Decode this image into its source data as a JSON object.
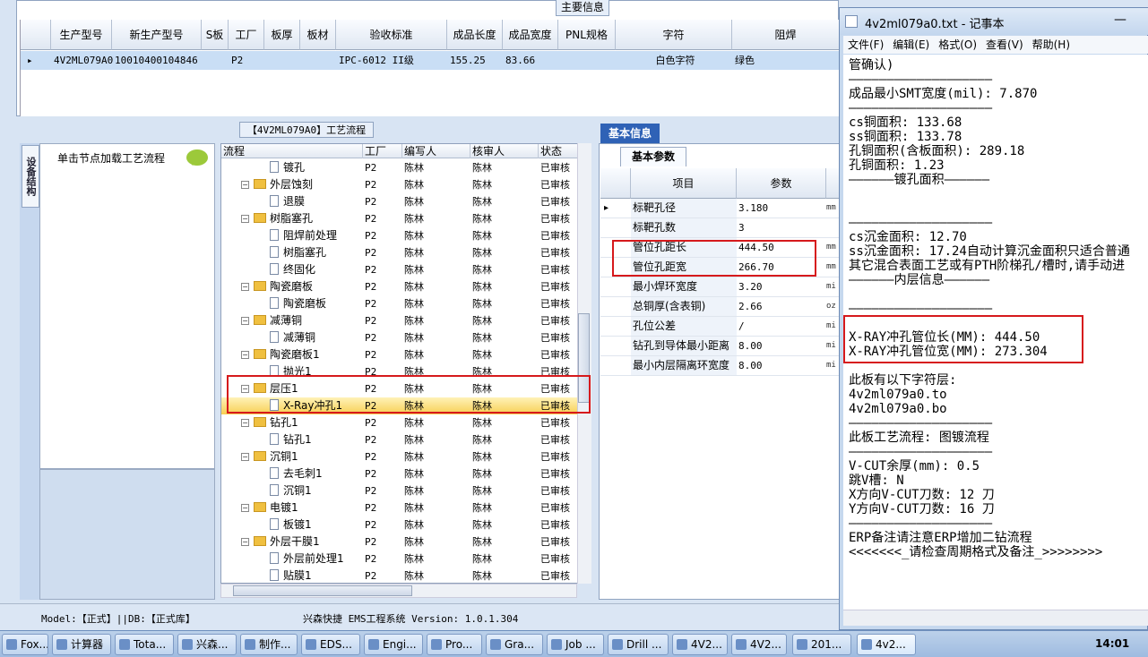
{
  "top_panel": {
    "title": "主要信息",
    "columns": [
      "生产型号",
      "新生产型号",
      "S板",
      "工厂",
      "板厚",
      "板材",
      "验收标准",
      "成品长度",
      "成品宽度",
      "PNL规格",
      "字符",
      "阻焊"
    ],
    "row": {
      "model": "4V2ML079A0",
      "new_model": "10010400104846",
      "factory": "P2",
      "standard": "IPC-6012 II级",
      "length": "155.25",
      "width": "83.66",
      "char": "白色字符",
      "mask": "绿色"
    }
  },
  "flow_panel": {
    "title": "【4V2ML079A0】工艺流程",
    "device_tab": "设备结构",
    "device_hint": "单击节点加载工艺流程",
    "columns": [
      "流程",
      "工厂",
      "编写人",
      "核审人",
      "状态"
    ],
    "rows": [
      {
        "name": "镀孔",
        "level": 1,
        "factory": "P2",
        "writer": "陈林",
        "reviewer": "陈林",
        "status": "已审核"
      },
      {
        "name": "外层蚀刻",
        "level": 0,
        "factory": "P2",
        "writer": "陈林",
        "reviewer": "陈林",
        "status": "已审核"
      },
      {
        "name": "退膜",
        "level": 1,
        "factory": "P2",
        "writer": "陈林",
        "reviewer": "陈林",
        "status": "已审核"
      },
      {
        "name": "树脂塞孔",
        "level": 0,
        "factory": "P2",
        "writer": "陈林",
        "reviewer": "陈林",
        "status": "已审核"
      },
      {
        "name": "阻焊前处理",
        "level": 1,
        "factory": "P2",
        "writer": "陈林",
        "reviewer": "陈林",
        "status": "已审核"
      },
      {
        "name": "树脂塞孔",
        "level": 1,
        "factory": "P2",
        "writer": "陈林",
        "reviewer": "陈林",
        "status": "已审核"
      },
      {
        "name": "终固化",
        "level": 1,
        "factory": "P2",
        "writer": "陈林",
        "reviewer": "陈林",
        "status": "已审核"
      },
      {
        "name": "陶瓷磨板",
        "level": 0,
        "factory": "P2",
        "writer": "陈林",
        "reviewer": "陈林",
        "status": "已审核"
      },
      {
        "name": "陶瓷磨板",
        "level": 1,
        "factory": "P2",
        "writer": "陈林",
        "reviewer": "陈林",
        "status": "已审核"
      },
      {
        "name": "减薄铜",
        "level": 0,
        "factory": "P2",
        "writer": "陈林",
        "reviewer": "陈林",
        "status": "已审核"
      },
      {
        "name": "减薄铜",
        "level": 1,
        "factory": "P2",
        "writer": "陈林",
        "reviewer": "陈林",
        "status": "已审核"
      },
      {
        "name": "陶瓷磨板1",
        "level": 0,
        "factory": "P2",
        "writer": "陈林",
        "reviewer": "陈林",
        "status": "已审核"
      },
      {
        "name": "抛光1",
        "level": 1,
        "factory": "P2",
        "writer": "陈林",
        "reviewer": "陈林",
        "status": "已审核"
      },
      {
        "name": "层压1",
        "level": 0,
        "factory": "P2",
        "writer": "陈林",
        "reviewer": "陈林",
        "status": "已审核"
      },
      {
        "name": "X-Ray冲孔1",
        "level": 1,
        "factory": "P2",
        "writer": "陈林",
        "reviewer": "陈林",
        "status": "已审核",
        "selected": true
      },
      {
        "name": "钻孔1",
        "level": 0,
        "factory": "P2",
        "writer": "陈林",
        "reviewer": "陈林",
        "status": "已审核"
      },
      {
        "name": "钻孔1",
        "level": 1,
        "factory": "P2",
        "writer": "陈林",
        "reviewer": "陈林",
        "status": "已审核"
      },
      {
        "name": "沉铜1",
        "level": 0,
        "factory": "P2",
        "writer": "陈林",
        "reviewer": "陈林",
        "status": "已审核"
      },
      {
        "name": "去毛刺1",
        "level": 1,
        "factory": "P2",
        "writer": "陈林",
        "reviewer": "陈林",
        "status": "已审核"
      },
      {
        "name": "沉铜1",
        "level": 1,
        "factory": "P2",
        "writer": "陈林",
        "reviewer": "陈林",
        "status": "已审核"
      },
      {
        "name": "电镀1",
        "level": 0,
        "factory": "P2",
        "writer": "陈林",
        "reviewer": "陈林",
        "status": "已审核"
      },
      {
        "name": "板镀1",
        "level": 1,
        "factory": "P2",
        "writer": "陈林",
        "reviewer": "陈林",
        "status": "已审核"
      },
      {
        "name": "外层干膜1",
        "level": 0,
        "factory": "P2",
        "writer": "陈林",
        "reviewer": "陈林",
        "status": "已审核"
      },
      {
        "name": "外层前处理1",
        "level": 1,
        "factory": "P2",
        "writer": "陈林",
        "reviewer": "陈林",
        "status": "已审核"
      },
      {
        "name": "贴膜1",
        "level": 1,
        "factory": "P2",
        "writer": "陈林",
        "reviewer": "陈林",
        "status": "已审核"
      }
    ]
  },
  "basic_info": {
    "tab": "基本信息",
    "sub_tab": "基本参数",
    "columns": [
      "项目",
      "参数"
    ],
    "rows": [
      {
        "item": "标靶孔径",
        "value": "3.180",
        "unit": "mm"
      },
      {
        "item": "标靶孔数",
        "value": "3",
        "unit": ""
      },
      {
        "item": "管位孔距长",
        "value": "444.50",
        "unit": "mm"
      },
      {
        "item": "管位孔距宽",
        "value": "266.70",
        "unit": "mm"
      },
      {
        "item": "最小焊环宽度",
        "value": "3.20",
        "unit": "mi"
      },
      {
        "item": "总铜厚(含表铜)",
        "value": "2.66",
        "unit": "oz"
      },
      {
        "item": "孔位公差",
        "value": "/",
        "unit": "mi"
      },
      {
        "item": "钻孔到导体最小距离",
        "value": "8.00",
        "unit": "mi"
      },
      {
        "item": "最小内层隔离环宽度",
        "value": "8.00",
        "unit": "mi"
      }
    ]
  },
  "status_bar": {
    "left": "Model:【正式】||DB:【正式库】",
    "center": "兴森快捷 EMS工程系统 Version: 1.0.1.304"
  },
  "notepad": {
    "title": "4v2ml079a0.txt - 记事本",
    "menu": [
      "文件(F)",
      "编辑(E)",
      "格式(O)",
      "查看(V)",
      "帮助(H)"
    ],
    "lines": [
      "管确认)",
      "———————————————————",
      "成品最小SMT宽度(mil): 7.870",
      "———————————————————",
      "cs铜面积: 133.68",
      "ss铜面积: 133.78",
      "孔铜面积(含板面积): 289.18",
      "孔铜面积: 1.23",
      "——————镀孔面积——————",
      "",
      "",
      "———————————————————",
      "cs沉金面积: 12.70",
      "ss沉金面积: 17.24自动计算沉金面积只适合普通",
      "其它混合表面工艺或有PTH阶梯孔/槽时,请手动进",
      "——————内层信息——————",
      "",
      "———————————————————",
      "",
      "X-RAY冲孔管位长(MM): 444.50",
      "X-RAY冲孔管位宽(MM): 273.304",
      "",
      "此板有以下字符层:",
      "4v2ml079a0.to",
      "4v2ml079a0.bo",
      "———————————————————",
      "此板工艺流程: 图镀流程",
      "———————————————————",
      "V-CUT余厚(mm): 0.5",
      "跳V槽: N",
      "X方向V-CUT刀数: 12 刀",
      "Y方向V-CUT刀数: 16 刀",
      "———————————————————",
      "ERP备注请注意ERP增加二钻流程",
      "<<<<<<<_请检查周期格式及备注_>>>>>>>>"
    ]
  },
  "taskbar": {
    "items": [
      "Fox...",
      "计算器",
      "Tota...",
      "兴森...",
      "制作...",
      "EDS...",
      "Engi...",
      "Pro...",
      "Gra...",
      "Job ...",
      "Drill ...",
      "4V2...",
      "4V2...",
      "201...",
      "4v2..."
    ],
    "clock": "14:01"
  }
}
